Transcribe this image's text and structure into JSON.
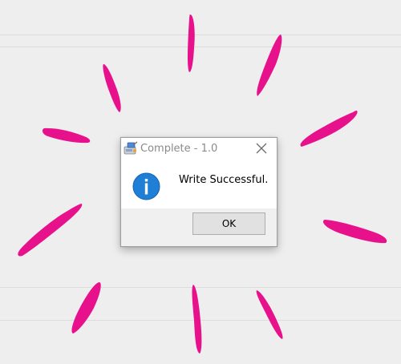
{
  "dialog": {
    "title": "Complete - 1.0",
    "message": "Write Successful.",
    "ok_label": "OK",
    "app_icon": "app-disk-icon",
    "close_icon": "close-icon",
    "message_icon": "info-icon"
  },
  "colors": {
    "burst": "#e8118c",
    "info_blue": "#1f7fd6",
    "background": "#efeeef"
  }
}
